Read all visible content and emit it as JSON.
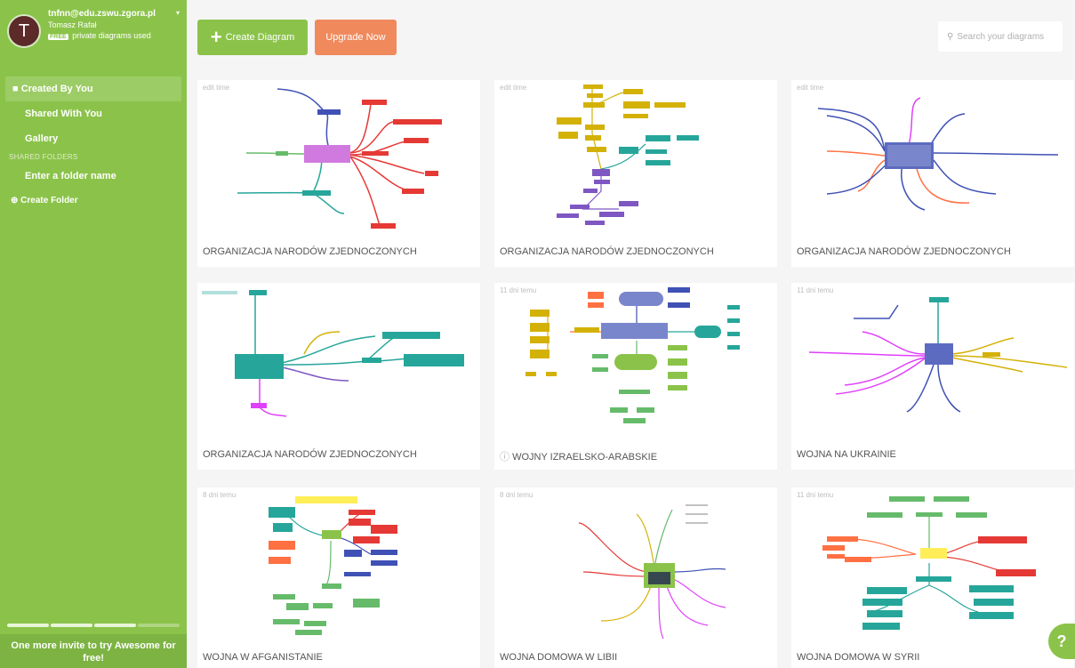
{
  "user": {
    "avatar_letter": "T",
    "email": "tnfnn@edu.zswu.zgora.pl",
    "name": "Tomasz Rafał",
    "plan_badge": "FREE",
    "plan_text": "private diagrams used"
  },
  "nav": {
    "created": "Created By You",
    "shared": "Shared With You",
    "gallery": "Gallery",
    "shared_folders": "SHARED FOLDERS",
    "folder_placeholder": "Enter a folder name",
    "create_folder": "Create Folder"
  },
  "footer": {
    "invite": "One more invite to try Awesome for free!"
  },
  "header": {
    "create_label": "Create Diagram",
    "upgrade_label": "Upgrade Now",
    "search_placeholder": "Search your diagrams"
  },
  "cards": [
    {
      "meta": "edit time",
      "title": "ORGANIZACJA NARODÓW ZJEDNOCZONYCH"
    },
    {
      "meta": "edit time",
      "title": "ORGANIZACJA NARODÓW ZJEDNOCZONYCH"
    },
    {
      "meta": "edit time",
      "title": "ORGANIZACJA NARODÓW ZJEDNOCZONYCH"
    },
    {
      "meta": "",
      "title": "ORGANIZACJA NARODÓW ZJEDNOCZONYCH"
    },
    {
      "meta": "11 dni temu",
      "title": "WOJNY IZRAELSKO-ARABSKIE"
    },
    {
      "meta": "11 dni temu",
      "title": "WOJNA NA UKRAINIE"
    },
    {
      "meta": "8 dni temu",
      "title": "WOJNA W AFGANISTANIE"
    },
    {
      "meta": "8 dni temu",
      "title": "WOJNA DOMOWA W LIBII"
    },
    {
      "meta": "11 dni temu",
      "title": "WOJNA DOMOWA W SYRII"
    }
  ],
  "colors": {
    "sidebar": "#8bc34a",
    "upgrade": "#f08a5d"
  }
}
